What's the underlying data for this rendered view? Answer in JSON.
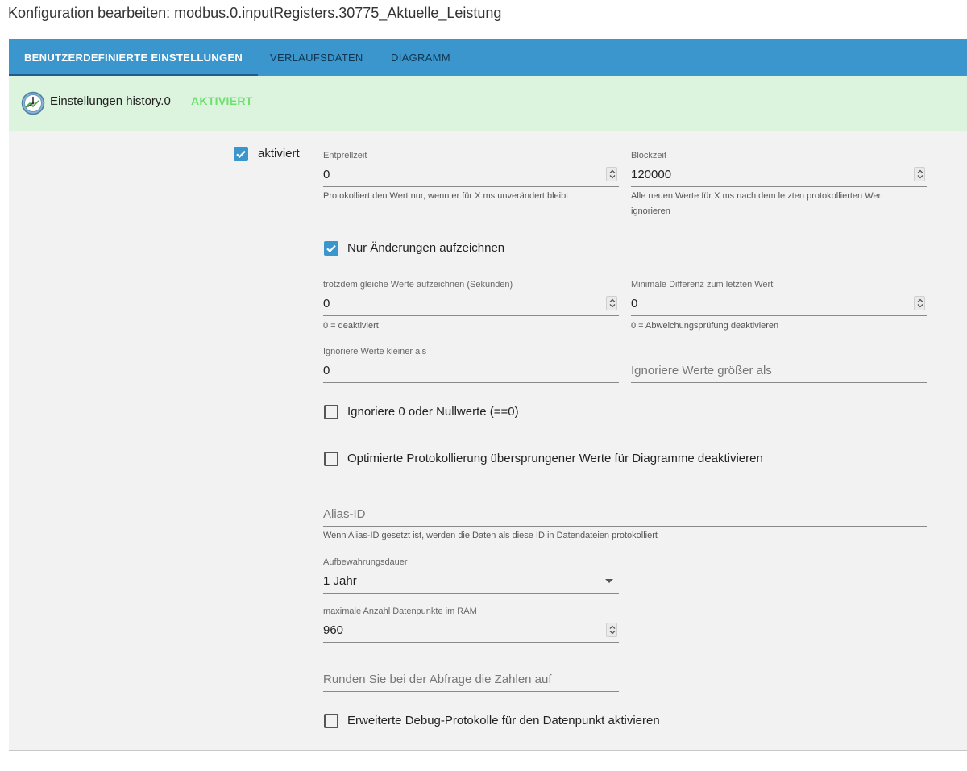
{
  "dialog": {
    "title": "Konfiguration bearbeiten: modbus.0.inputRegisters.30775_Aktuelle_Leistung"
  },
  "tabs": [
    {
      "label": "BENUTZERDEFINIERTE EINSTELLUNGEN",
      "active": true
    },
    {
      "label": "VERLAUFSDATEN",
      "active": false
    },
    {
      "label": "DIAGRAMM",
      "active": false
    }
  ],
  "banner": {
    "label": "Einstellungen history.0",
    "status": "AKTIVIERT",
    "icon": "clock-icon"
  },
  "enabled": {
    "label": "aktiviert",
    "checked": true
  },
  "debounce": {
    "label": "Entprellzeit",
    "value": "0",
    "help": "Protokolliert den Wert nur, wenn er für X ms unverändert bleibt"
  },
  "blocktime": {
    "label": "Blockzeit",
    "value": "120000",
    "help_line1": "Alle neuen Werte für X ms nach dem letzten protokollierten Wert",
    "help_line2": "ignorieren"
  },
  "changes_only": {
    "label": "Nur Änderungen aufzeichnen",
    "checked": true
  },
  "record_same": {
    "label": "trotzdem gleiche Werte aufzeichnen (Sekunden)",
    "value": "0",
    "help": "0 = deaktiviert"
  },
  "min_diff": {
    "label": "Minimale Differenz zum letzten Wert",
    "value": "0",
    "help": "0 = Abweichungsprüfung deaktivieren"
  },
  "ignore_below": {
    "label": "Ignoriere Werte kleiner als",
    "value": "0"
  },
  "ignore_above": {
    "placeholder": "Ignoriere Werte größer als"
  },
  "ignore_zero": {
    "label": "Ignoriere 0 oder Nullwerte (==0)",
    "checked": false
  },
  "disable_optimized": {
    "label": "Optimierte Protokollierung übersprungener Werte für Diagramme deaktivieren",
    "checked": false
  },
  "alias": {
    "placeholder": "Alias-ID",
    "help": "Wenn Alias-ID gesetzt ist, werden die Daten als diese ID in Datendateien protokolliert"
  },
  "retention": {
    "label": "Aufbewahrungsdauer",
    "value": "1 Jahr"
  },
  "max_ram": {
    "label": "maximale Anzahl Datenpunkte im RAM",
    "value": "960"
  },
  "round": {
    "placeholder": "Runden Sie bei der Abfrage die Zahlen auf"
  },
  "debug": {
    "label": "Erweiterte Debug-Protokolle für den Datenpunkt aktivieren",
    "checked": false
  },
  "colors": {
    "tab_bar": "#3a96cc",
    "banner_bg": "#dcf4dd",
    "status_green": "#6ee06f",
    "checkbox": "#3a96cc",
    "content_bg": "#f2f2f2"
  }
}
